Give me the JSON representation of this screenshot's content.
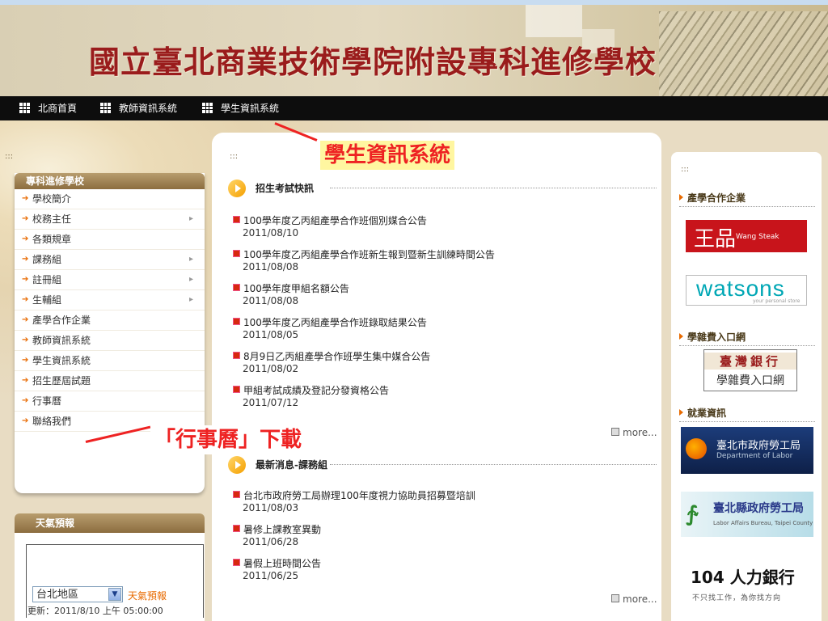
{
  "banner": {
    "title": "國立臺北商業技術學院附設專科進修學校"
  },
  "nav": {
    "items": [
      {
        "label": "北商首頁"
      },
      {
        "label": "教師資訊系統"
      },
      {
        "label": "學生資訊系統"
      }
    ]
  },
  "left": {
    "dots": ":::",
    "menu_title": "專科進修學校",
    "menu": [
      {
        "label": "學校簡介"
      },
      {
        "label": "校務主任",
        "has_sub": true
      },
      {
        "label": "各類規章"
      },
      {
        "label": "課務組",
        "has_sub": true
      },
      {
        "label": "註冊組",
        "has_sub": true
      },
      {
        "label": "生輔組",
        "has_sub": true
      },
      {
        "label": "產學合作企業"
      },
      {
        "label": "教師資訊系統"
      },
      {
        "label": "學生資訊系統"
      },
      {
        "label": "招生歷屆試題"
      },
      {
        "label": "行事曆"
      },
      {
        "label": "聯絡我們"
      }
    ],
    "weather": {
      "title": "天氣預報",
      "region": "台北地區",
      "link": "天氣預報",
      "updated": "更新：2011/8/10 上午 05:00:00"
    }
  },
  "center": {
    "dots": ":::",
    "sections": [
      {
        "title": "招生考試快訊",
        "more": "more...",
        "items": [
          {
            "title": "100學年度乙丙組產學合作班個別媒合公告",
            "date": "2011/08/10"
          },
          {
            "title": "100學年度乙丙組產學合作班新生報到暨新生訓練時間公告",
            "date": "2011/08/08"
          },
          {
            "title": "100學年度甲組名額公告",
            "date": "2011/08/08"
          },
          {
            "title": "100學年度乙丙組產學合作班錄取結果公告",
            "date": "2011/08/05"
          },
          {
            "title": "8月9日乙丙組產學合作班學生集中媒合公告",
            "date": "2011/08/02"
          },
          {
            "title": "甲組考試成績及登記分發資格公告",
            "date": "2011/07/12"
          }
        ]
      },
      {
        "title": "最新消息-課務組",
        "more": "more...",
        "items": [
          {
            "title": "台北市政府勞工局辦理100年度視力協助員招募暨培訓",
            "date": "2011/08/03"
          },
          {
            "title": "暑修上課教室異動",
            "date": "2011/06/28"
          },
          {
            "title": "暑假上班時間公告",
            "date": "2011/06/25"
          }
        ]
      }
    ]
  },
  "annotations": [
    {
      "text": "學生資訊系統"
    },
    {
      "text": "「行事曆」下載"
    }
  ],
  "right": {
    "dots": ":::",
    "headings": [
      {
        "label": "產學合作企業"
      },
      {
        "label": "學雜費入口網"
      },
      {
        "label": "就業資訊"
      }
    ],
    "logos": {
      "wang": {
        "big": "王品",
        "small": "Wang Steak"
      },
      "watsons": {
        "big": "watsons",
        "small": "your personal store"
      },
      "taiwanbank": {
        "line1": "臺灣銀行",
        "line2": "學雜費入口網"
      },
      "labor_taipei_city": {
        "line1": "臺北市政府勞工局",
        "line2": "Department of Labor"
      },
      "labor_taipei_county": {
        "line1": "臺北縣政府勞工局",
        "line2": "Labor Affairs Bureau, Taipei County"
      },
      "jobbank104": {
        "line1": "104 人力銀行",
        "line2": "不只找工作，為你找方向"
      }
    }
  },
  "colors": {
    "accent_red": "#e22222",
    "title_red": "#9a1c1c",
    "nav_bg": "#0d0d0d",
    "highlight": "#fff6a0"
  }
}
